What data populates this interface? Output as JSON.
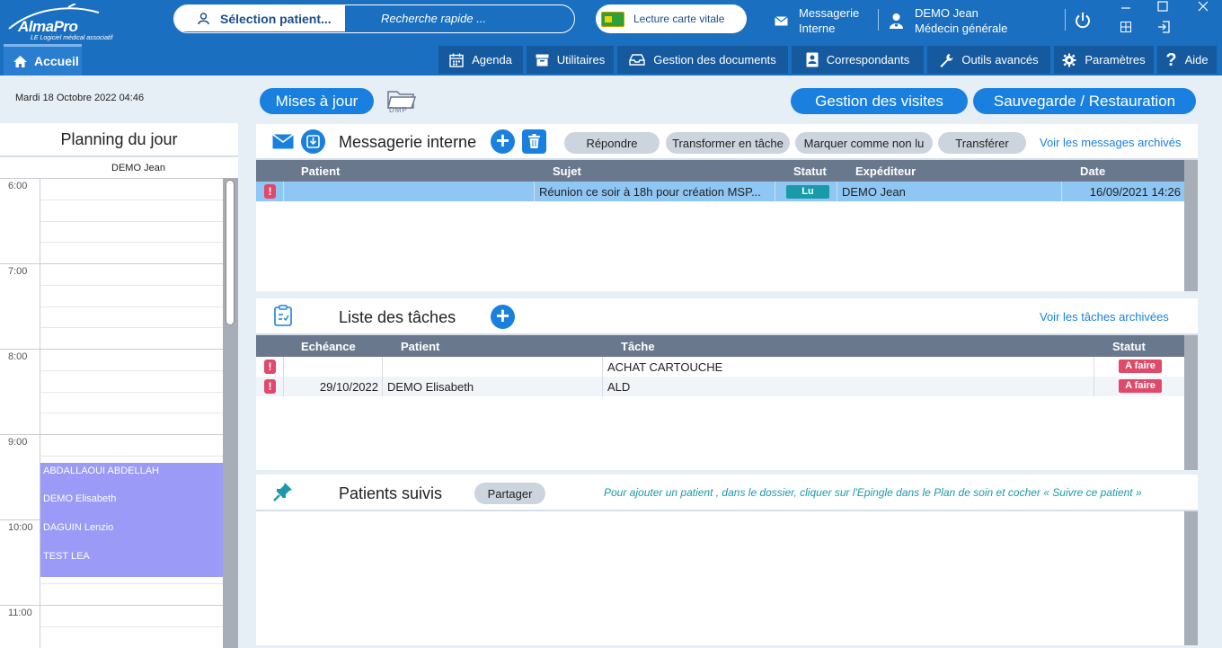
{
  "app": {
    "logo_name": "AlmaPro",
    "logo_tagline": "LE Logiciel médical associatif"
  },
  "topbar": {
    "patient_select": "Sélection patient...",
    "quick_search_placeholder": "Recherche rapide ...",
    "vitale": "Lecture carte vitale",
    "messaging_line1": "Messagerie",
    "messaging_line2": "Interne",
    "user_name": "DEMO Jean",
    "user_role": "Médecin générale"
  },
  "nav": {
    "home": "Accueil",
    "menu": [
      "Agenda",
      "Utilitaires",
      "Gestion des documents",
      "Correspondants",
      "Outils avancés",
      "Paramètres",
      "Aide"
    ]
  },
  "subheader": {
    "date": "Mardi 18 Octobre 2022 04:46",
    "updates": "Mises à jour",
    "dmp": "DMP",
    "visits": "Gestion des visites",
    "backup": "Sauvegarde / Restauration"
  },
  "planning": {
    "title": "Planning du jour",
    "user": "DEMO Jean",
    "hours": [
      "6:00",
      "7:00",
      "8:00",
      "9:00",
      "10:00",
      "11:00"
    ],
    "appointments": [
      "ABDALLAOUI ABDELLAH",
      "DEMO Elisabeth",
      "DAGUIN Lenzio",
      "TEST LEA"
    ]
  },
  "messaging": {
    "title": "Messagerie interne",
    "actions": [
      "Répondre",
      "Transformer en tâche",
      "Marquer comme non lu",
      "Transférer"
    ],
    "archive_link": "Voir les messages archivés",
    "columns": [
      "Patient",
      "Sujet",
      "Statut",
      "Expéditeur",
      "Date"
    ],
    "rows": [
      {
        "patient": "",
        "subject": "Réunion ce soir à 18h pour création MSP...",
        "status": "Lu",
        "sender": "DEMO Jean",
        "date": "16/09/2021 14:26"
      }
    ]
  },
  "tasks": {
    "title": "Liste des tâches",
    "archive_link": "Voir les tâches archivées",
    "columns": [
      "Echéance",
      "Patient",
      "Tâche",
      "Statut"
    ],
    "rows": [
      {
        "due": "",
        "patient": "",
        "task": "ACHAT CARTOUCHE",
        "status": "A faire"
      },
      {
        "due": "29/10/2022",
        "patient": "DEMO Elisabeth",
        "task": "ALD",
        "status": "A faire"
      }
    ]
  },
  "followed": {
    "title": "Patients suivis",
    "share": "Partager",
    "hint": "Pour ajouter un patient , dans le dossier, cliquer sur l'Epingle dans le Plan de soin et cocher « Suivre ce patient »"
  },
  "colors": {
    "header_blue": "#1a6fc0",
    "accent_blue": "#1a80e0",
    "appointment": "#9b9bf7",
    "badge_read": "#1a9aa8",
    "badge_todo": "#e0496a",
    "warning": "#e0496a"
  }
}
